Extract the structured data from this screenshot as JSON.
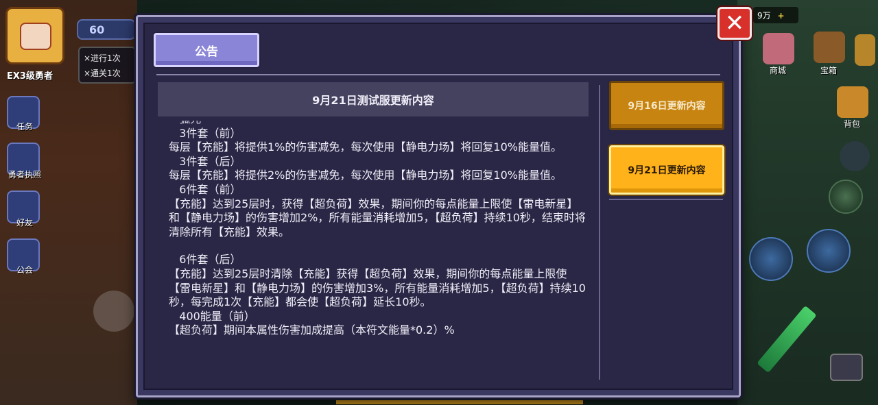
{
  "hud": {
    "hero_rank": "EX3级勇者",
    "level": "60",
    "quests": [
      "×进行1次",
      "×通关1次"
    ],
    "left_menu": [
      "任务",
      "勇者执照",
      "好友",
      "公会"
    ],
    "currency": "9万",
    "right_menu": [
      "商城",
      "宝箱",
      "背包"
    ]
  },
  "modal": {
    "tab_label": "公告",
    "close_label": "✕",
    "content_title": "9月21日测试服更新内容",
    "content_lines": [
      "   3件套（前）",
      "每层【充能】将提供1%的伤害减免，每次使用【静电力场】将回复10%能量值。",
      "   3件套（后）",
      "每层【充能】将提供2%的伤害减免，每次使用【静电力场】将回复10%能量值。",
      "   6件套（前）",
      "【充能】达到25层时，获得【超负荷】效果，期间你的每点能量上限使【雷电新星】和【静电力场】的伤害增加2%，所有能量消耗增加5，【超负荷】持续10秒，结束时将清除所有【充能】效果。",
      "",
      "   6件套（后）",
      "【充能】达到25层时清除【充能】获得【超负荷】效果，期间你的每点能量上限使【雷电新星】和【静电力场】的伤害增加3%，所有能量消耗增加5，【超负荷】持续10秒，每完成1次【充能】都会使【超负荷】延长10秒。",
      "   400能量（前）",
      "【超负荷】期间本属性伤害加成提高（本符文能量*0.2）%"
    ],
    "versions": [
      {
        "label": "9月16日更新内容",
        "selected": false
      },
      {
        "label": "9月21日更新内容",
        "selected": true
      }
    ]
  },
  "colors": {
    "modal_bg": "#2a2746",
    "tab_active": "#8b85d8",
    "version_selected": "#ffb21a",
    "version_unselected": "#c88410",
    "close_red": "#d8302a"
  }
}
